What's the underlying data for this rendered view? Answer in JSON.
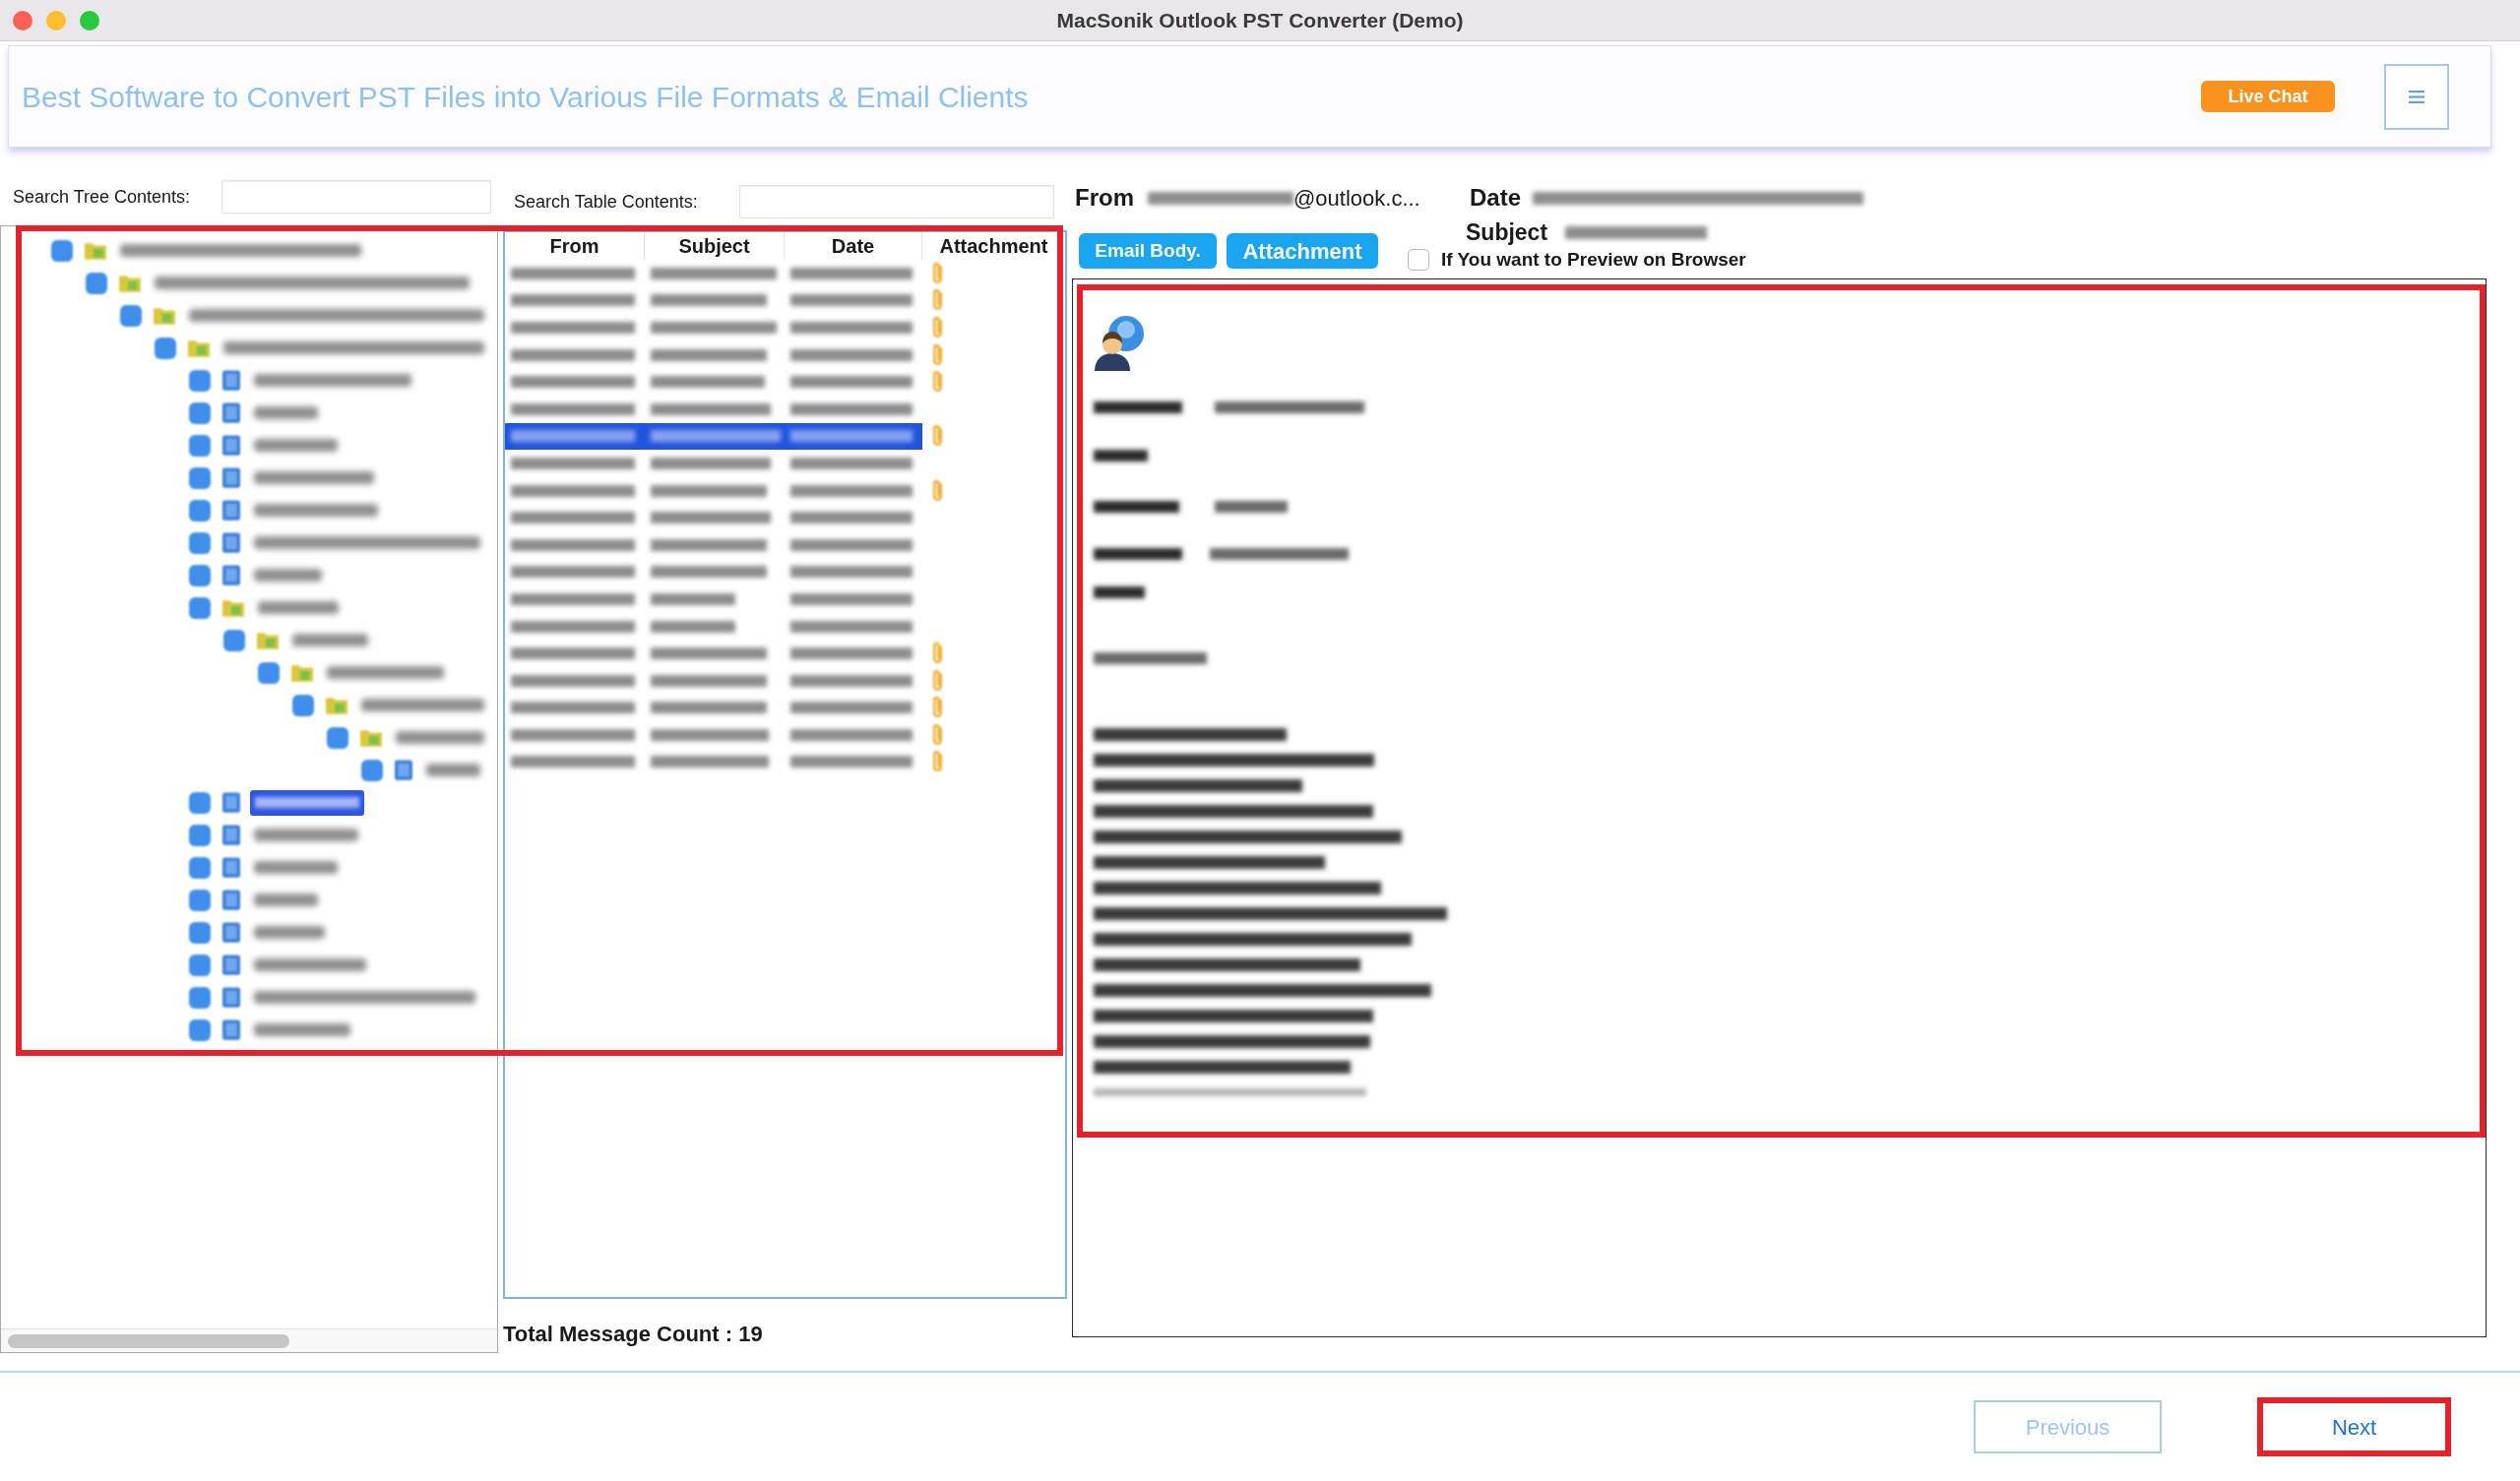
{
  "window": {
    "title": "MacSonik Outlook PST Converter (Demo)"
  },
  "banner": {
    "tagline": "Best Software to Convert PST Files into Various File Formats & Email Clients",
    "live_chat_button": "Live Chat"
  },
  "tree_search": {
    "label": "Search Tree Contents:"
  },
  "table_search": {
    "label": "Search Table Contents:"
  },
  "browse_panes": {
    "highlighted": true
  },
  "folder_tree": {
    "nodes": [
      {
        "kind": "container",
        "checked": true,
        "selected": false,
        "children": [
          {
            "kind": "container",
            "checked": true,
            "selected": false,
            "children": [
              {
                "kind": "container",
                "checked": true,
                "selected": false,
                "children": [
                  {
                    "kind": "container",
                    "checked": true,
                    "selected": false,
                    "children": [
                      {
                        "kind": "folder",
                        "checked": true,
                        "selected": false
                      },
                      {
                        "kind": "folder",
                        "checked": true,
                        "selected": false
                      },
                      {
                        "kind": "folder",
                        "checked": true,
                        "selected": false
                      },
                      {
                        "kind": "folder",
                        "checked": true,
                        "selected": false
                      },
                      {
                        "kind": "folder",
                        "checked": true,
                        "selected": false
                      },
                      {
                        "kind": "folder",
                        "checked": true,
                        "selected": false
                      },
                      {
                        "kind": "folder",
                        "checked": true,
                        "selected": false
                      },
                      {
                        "kind": "container",
                        "checked": true,
                        "selected": false,
                        "children": [
                          {
                            "kind": "container",
                            "checked": true,
                            "selected": false,
                            "children": [
                              {
                                "kind": "container",
                                "checked": true,
                                "selected": false,
                                "children": [
                                  {
                                    "kind": "container",
                                    "checked": true,
                                    "selected": false,
                                    "children": [
                                      {
                                        "kind": "container",
                                        "checked": true,
                                        "selected": false,
                                        "children": [
                                          {
                                            "kind": "folder",
                                            "checked": true,
                                            "selected": false
                                          }
                                        ]
                                      }
                                    ]
                                  }
                                ]
                              }
                            ]
                          }
                        ]
                      },
                      {
                        "kind": "folder",
                        "checked": true,
                        "selected": true
                      },
                      {
                        "kind": "folder",
                        "checked": true,
                        "selected": false
                      },
                      {
                        "kind": "folder",
                        "checked": true,
                        "selected": false
                      },
                      {
                        "kind": "folder",
                        "checked": true,
                        "selected": false
                      },
                      {
                        "kind": "folder",
                        "checked": true,
                        "selected": false
                      },
                      {
                        "kind": "folder",
                        "checked": true,
                        "selected": false
                      },
                      {
                        "kind": "folder",
                        "checked": true,
                        "selected": false
                      },
                      {
                        "kind": "folder",
                        "checked": true,
                        "selected": false
                      }
                    ]
                  }
                ]
              }
            ]
          }
        ]
      }
    ]
  },
  "message_table": {
    "columns": [
      "From",
      "Subject",
      "Date",
      "Attachment"
    ],
    "rows": [
      {
        "selected": false,
        "attachment": true
      },
      {
        "selected": false,
        "attachment": true
      },
      {
        "selected": false,
        "attachment": true
      },
      {
        "selected": false,
        "attachment": true
      },
      {
        "selected": false,
        "attachment": true
      },
      {
        "selected": false,
        "attachment": false
      },
      {
        "selected": true,
        "attachment": true
      },
      {
        "selected": false,
        "attachment": false
      },
      {
        "selected": false,
        "attachment": true
      },
      {
        "selected": false,
        "attachment": false
      },
      {
        "selected": false,
        "attachment": false
      },
      {
        "selected": false,
        "attachment": false
      },
      {
        "selected": false,
        "attachment": false
      },
      {
        "selected": false,
        "attachment": false
      },
      {
        "selected": false,
        "attachment": true
      },
      {
        "selected": false,
        "attachment": true
      },
      {
        "selected": false,
        "attachment": true
      },
      {
        "selected": false,
        "attachment": true
      },
      {
        "selected": false,
        "attachment": true
      }
    ]
  },
  "total_count": "Total Message Count : 19",
  "message_header": {
    "from_label": "From",
    "from_address_unblurred": "@outlook.c...",
    "date_label": "Date",
    "subject_label": "Subject"
  },
  "view_buttons": [
    "Email Body.",
    "Attachment"
  ],
  "preview_on_browser": {
    "label": "If You want to Preview on Browser",
    "checked": false
  },
  "preview": {
    "highlighted": true
  },
  "navigation": {
    "previous": {
      "label": "Previous",
      "disabled": true,
      "highlighted": false
    },
    "next": {
      "label": "Next",
      "disabled": false,
      "highlighted": true
    }
  }
}
